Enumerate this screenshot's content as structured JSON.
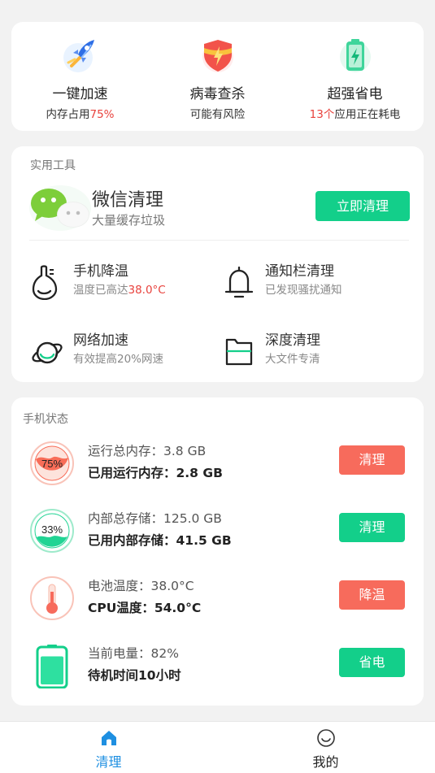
{
  "features": [
    {
      "title": "一键加速",
      "sub_prefix": "内存占用",
      "sub_highlight": "75%",
      "icon": "rocket-icon"
    },
    {
      "title": "病毒查杀",
      "sub_prefix": "",
      "sub_highlight": "可能有风险",
      "icon": "shield-icon"
    },
    {
      "title": "超强省电",
      "sub_highlight": "13个",
      "sub_suffix": "应用正在耗电",
      "icon": "battery-icon"
    }
  ],
  "tools": {
    "section_title": "实用工具",
    "wechat": {
      "title": "微信清理",
      "sub": "大量缓存垃圾",
      "button": "立即清理",
      "icon": "wechat-icon"
    },
    "items": [
      {
        "title": "手机降温",
        "sub_prefix": "温度已高达",
        "sub_highlight": "38.0°C",
        "icon": "thermometer-icon"
      },
      {
        "title": "通知栏清理",
        "sub_warning": "已发现骚扰通知",
        "icon": "bell-icon"
      },
      {
        "title": "网络加速",
        "sub": "有效提高20%网速",
        "icon": "planet-icon"
      },
      {
        "title": "深度清理",
        "sub": "大文件专清",
        "icon": "folder-icon"
      }
    ]
  },
  "status": {
    "section_title": "手机状态",
    "items": [
      {
        "line1": "运行总内存：3.8 GB",
        "line2": "已用运行内存：2.8 GB",
        "button": "清理",
        "badge": "75%",
        "level": 0.75,
        "icon": "memory-gauge-icon"
      },
      {
        "line1": "内部总存储：125.0 GB",
        "line2": "已用内部存储：41.5 GB",
        "button": "清理",
        "badge": "33%",
        "level": 0.33,
        "icon": "storage-gauge-icon"
      },
      {
        "line1": "电池温度：38.0°C",
        "line2": "CPU温度：54.0°C",
        "button": "降温",
        "icon": "temperature-icon"
      },
      {
        "line1": "当前电量：82%",
        "line2": "待机时间10小时",
        "button": "省电",
        "level": 0.82,
        "icon": "battery-level-icon"
      }
    ]
  },
  "tabs": [
    {
      "label": "清理",
      "active": true,
      "icon": "home-icon"
    },
    {
      "label": "我的",
      "active": false,
      "icon": "smiley-icon"
    }
  ],
  "colors": {
    "accent_green": "#13cf8a",
    "accent_coral": "#f76b5c",
    "warning_red": "#e8413c",
    "warning_orange": "#f0a020",
    "tab_active": "#1e8fe1"
  }
}
